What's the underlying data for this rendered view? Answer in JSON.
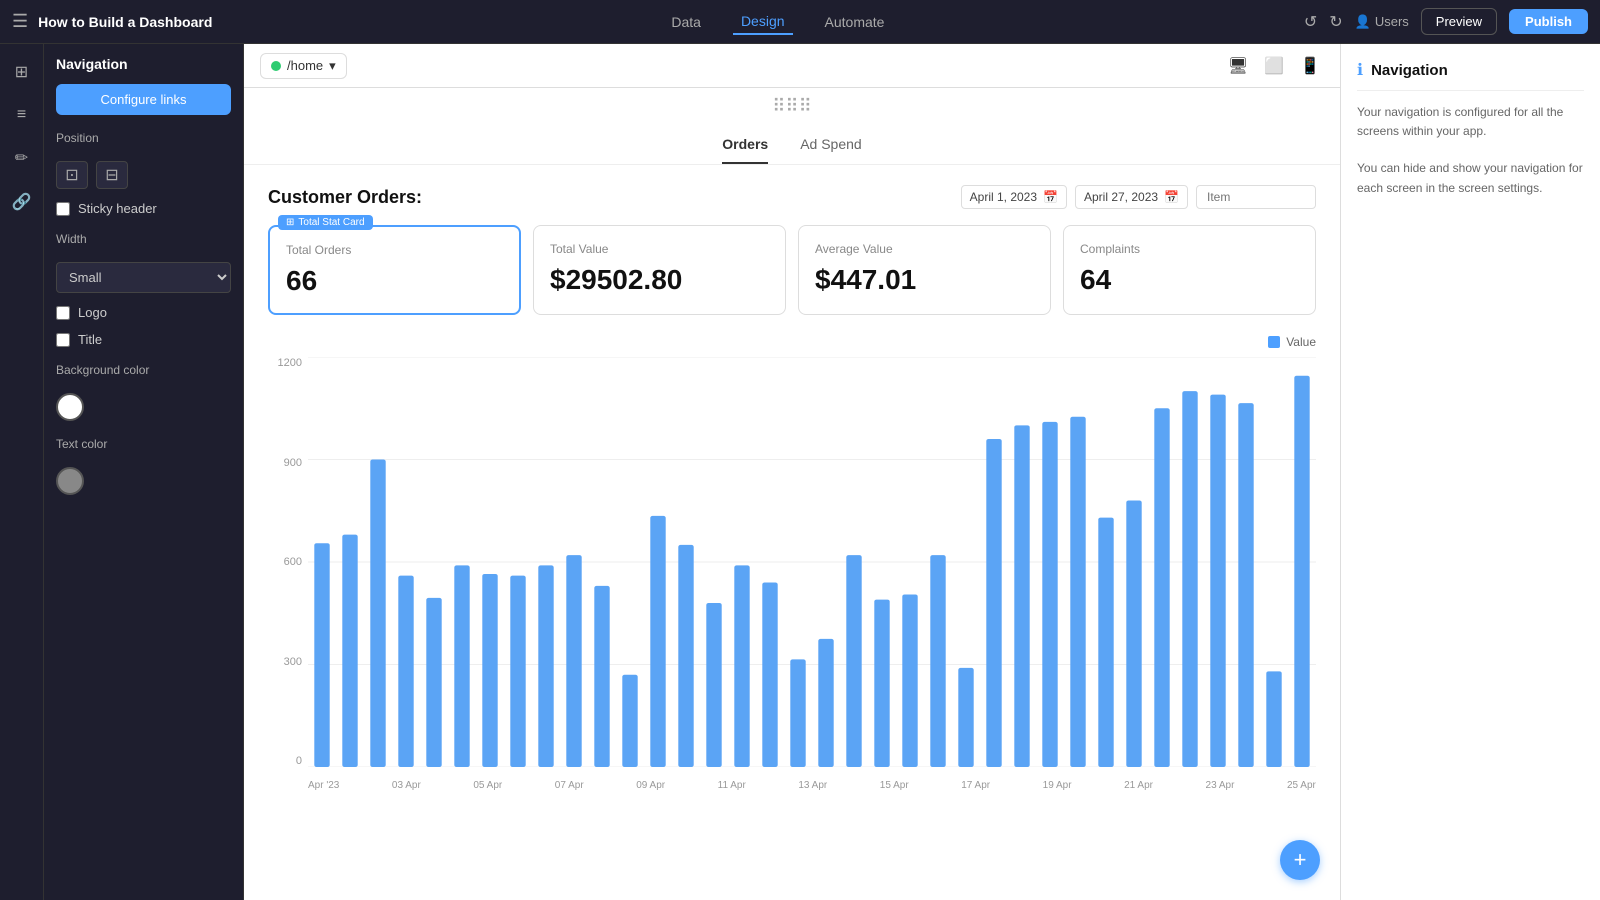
{
  "topbar": {
    "menu_icon": "☰",
    "title": "How to Build a Dashboard",
    "tabs": [
      {
        "label": "Data",
        "active": false
      },
      {
        "label": "Design",
        "active": true
      },
      {
        "label": "Automate",
        "active": false
      }
    ],
    "preview_label": "Preview",
    "publish_label": "Publish",
    "users_label": "Users"
  },
  "left_panel": {
    "title": "Navigation",
    "configure_btn": "Configure links",
    "position_label": "Position",
    "sticky_header_label": "Sticky header",
    "logo_label": "Logo",
    "title_label": "Title",
    "width_label": "Width",
    "width_value": "Small",
    "bg_color_label": "Background color",
    "text_color_label": "Text color"
  },
  "canvas": {
    "home_path": "/home",
    "dots": "⋮⋮⋮",
    "tabs": [
      {
        "label": "Orders",
        "active": true
      },
      {
        "label": "Ad Spend",
        "active": false
      }
    ],
    "stats_title": "Customer Orders:",
    "date_from": "April 1, 2023",
    "date_to": "April 27, 2023",
    "item_placeholder": "Item",
    "stat_card_tag": "Total Stat Card",
    "stats": [
      {
        "label": "Total Orders",
        "value": "66"
      },
      {
        "label": "Total Value",
        "value": "$29502.80"
      },
      {
        "label": "Average Value",
        "value": "$447.01"
      },
      {
        "label": "Complaints",
        "value": "64"
      }
    ],
    "legend_label": "Value",
    "y_labels": [
      "1200",
      "900",
      "600",
      "300",
      "0"
    ],
    "x_labels": [
      "Apr '23",
      "03 Apr",
      "05 Apr",
      "07 Apr",
      "09 Apr",
      "11 Apr",
      "13 Apr",
      "15 Apr",
      "17 Apr",
      "19 Apr",
      "21 Apr",
      "23 Apr",
      "25 Apr"
    ],
    "bars": [
      655,
      680,
      900,
      560,
      495,
      590,
      565,
      560,
      590,
      620,
      530,
      270,
      735,
      650,
      480,
      590,
      540,
      315,
      375,
      620,
      490,
      505,
      620,
      290,
      960,
      1000,
      1010,
      1025,
      730,
      780,
      1050,
      1100,
      1090,
      1065,
      280,
      1145
    ]
  },
  "right_panel": {
    "icon": "ℹ",
    "title": "Navigation",
    "text1": "Your navigation is configured for all the screens within your app.",
    "text2": "You can hide and show your navigation for each screen in the screen settings."
  }
}
